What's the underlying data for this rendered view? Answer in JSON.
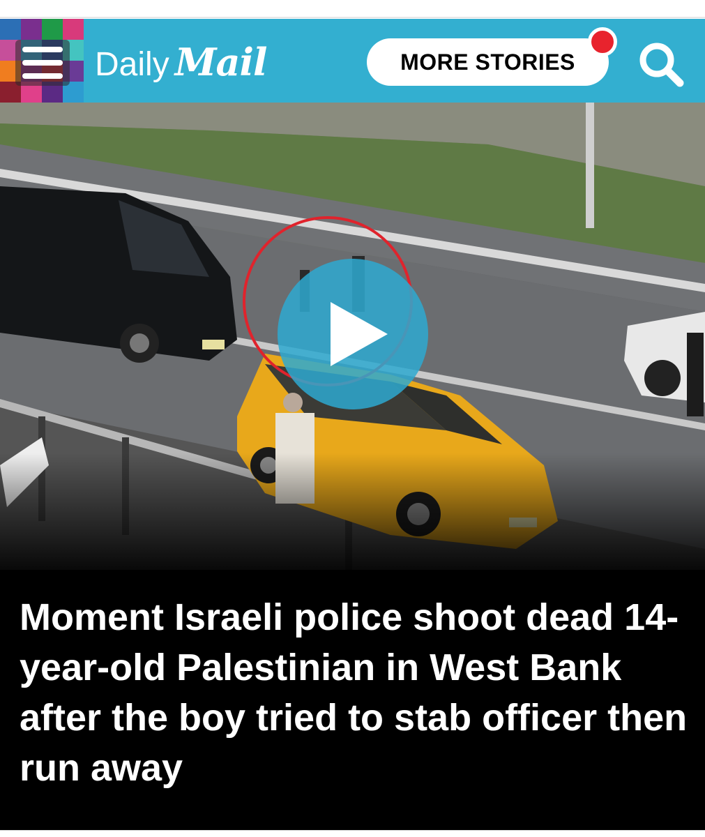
{
  "masthead": {
    "brand_daily": "Daily",
    "brand_mail": "Mail",
    "background_color": "#33afd0",
    "menu_icon": "hamburger-menu-icon",
    "more_stories_label": "MORE STORIES",
    "notification_color": "#e8232d",
    "search_icon": "search-icon"
  },
  "video": {
    "play_icon": "play-icon",
    "highlight_circle_color": "#e0232c"
  },
  "article": {
    "headline": "Moment Israeli police shoot dead 14-year-old Palestinian in West Bank after the boy tried to stab officer then run away"
  }
}
